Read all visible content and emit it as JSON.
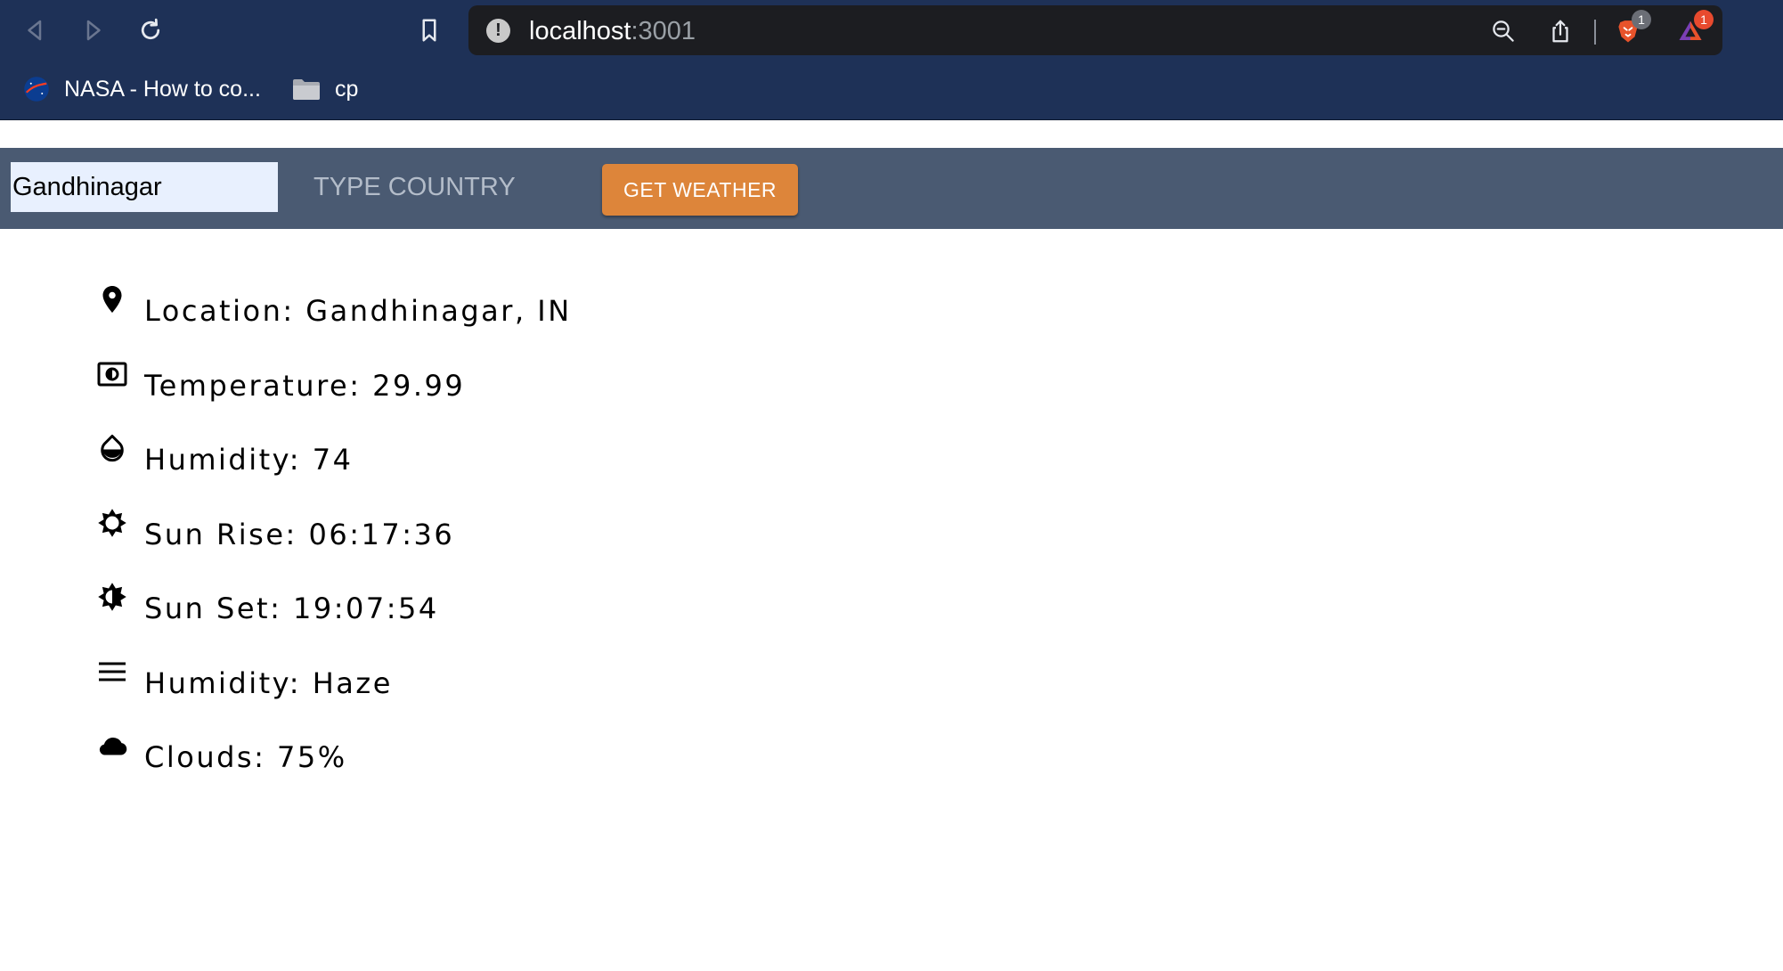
{
  "browser": {
    "url_host": "localhost",
    "url_port": ":3001",
    "shields_badge": "1",
    "rewards_badge": "1",
    "bookmarks": [
      {
        "label": "NASA - How to co..."
      },
      {
        "label": "cp"
      }
    ]
  },
  "form": {
    "city_value": "Gandhinagar",
    "country_placeholder": "TYPE COUNTRY",
    "button_label": "GET WEATHER"
  },
  "weather": {
    "location": "Location: Gandhinagar, IN",
    "temperature": "Temperature: 29.99",
    "humidity": "Humidity: 74",
    "sunrise": "Sun Rise: 06:17:36",
    "sunset": "Sun Set: 19:07:54",
    "condition": "Humidity: Haze",
    "clouds": "Clouds: 75%"
  },
  "colors": {
    "chrome_bg": "#1e3157",
    "toolbar_bg": "#4a5a72",
    "button_bg": "#dd853a",
    "input_bg": "#e8f0fe"
  }
}
